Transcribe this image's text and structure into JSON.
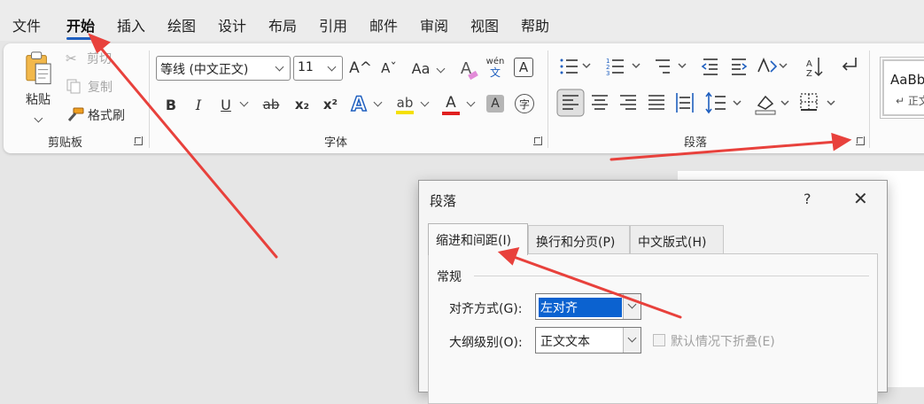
{
  "menu": {
    "tabs": [
      "文件",
      "开始",
      "插入",
      "绘图",
      "设计",
      "布局",
      "引用",
      "邮件",
      "审阅",
      "视图",
      "帮助"
    ],
    "active_index": 1
  },
  "ribbon": {
    "clipboard": {
      "label": "剪贴板",
      "paste": "粘贴",
      "cut": "剪切",
      "copy": "复制",
      "format_painter": "格式刷"
    },
    "font": {
      "label": "字体",
      "font_name": "等线 (中文正文)",
      "font_size": "11",
      "bold": "B",
      "italic": "I",
      "underline": "U",
      "strike": "ab",
      "subscript": "x₂",
      "superscript": "x²",
      "grow": "A^",
      "shrink": "Aˇ",
      "change_case": "Aa",
      "clear_format": "A",
      "phonetic_top": "wén",
      "phonetic_bottom": "文",
      "char_border": "A",
      "text_effect": "A",
      "highlight": "ab",
      "font_color": "A",
      "char_shading": "A",
      "enclose": "字"
    },
    "paragraph": {
      "label": "段落"
    },
    "styles": {
      "sample": "AaBbCcDd",
      "name": "↵ 正文"
    }
  },
  "dialog": {
    "title": "段落",
    "help": "?",
    "close": "✕",
    "tabs": [
      "缩进和间距(I)",
      "换行和分页(P)",
      "中文版式(H)"
    ],
    "active_tab": 0,
    "section": "常规",
    "alignment_label": "对齐方式(G):",
    "alignment_value": "左对齐",
    "outline_label": "大纲级别(O):",
    "outline_value": "正文文本",
    "collapse_label": "默认情况下折叠(E)"
  },
  "colors": {
    "accent": "#1f5fbf",
    "arrow": "#e8413c",
    "highlight_yellow": "#f5e000",
    "font_red": "#e02020",
    "selection": "#0b62d0"
  }
}
